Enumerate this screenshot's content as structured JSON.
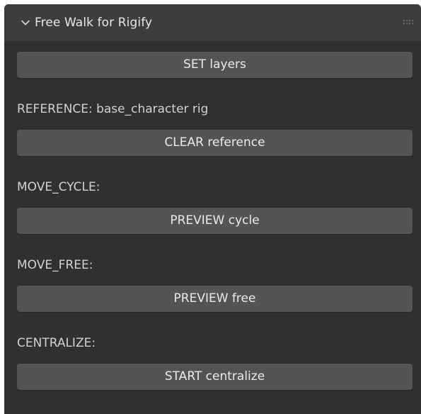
{
  "panel": {
    "title": "Free Walk for Rigify",
    "icons": {
      "collapse": "chevron-down-icon",
      "drag": "drag-grip-icon"
    }
  },
  "set_layers": {
    "button": "SET layers"
  },
  "reference": {
    "label": "REFERENCE: base_character rig",
    "button": "CLEAR reference"
  },
  "move_cycle": {
    "label": "MOVE_CYCLE:",
    "button": "PREVIEW cycle"
  },
  "move_free": {
    "label": "MOVE_FREE:",
    "button": "PREVIEW free"
  },
  "centralize": {
    "label": "CENTRALIZE:",
    "button": "START centralize"
  },
  "colors": {
    "panel_bg": "#303030",
    "header_bg": "#3d3d3d",
    "button_bg": "#545454",
    "text": "#e8e8e8"
  }
}
